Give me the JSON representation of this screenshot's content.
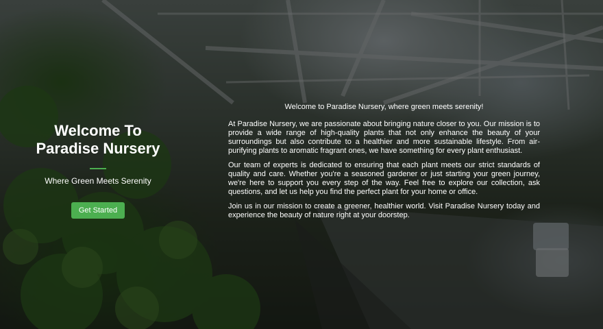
{
  "hero": {
    "title_line1": "Welcome To",
    "title_line2": "Paradise Nursery",
    "subtitle": "Where Green Meets Serenity",
    "cta_label": "Get Started",
    "accent_color": "#4caf50"
  },
  "about": {
    "intro": "Welcome to Paradise Nursery, where green meets serenity!",
    "paragraphs": [
      "At Paradise Nursery, we are passionate about bringing nature closer to you. Our mission is to provide a wide range of high-quality plants that not only enhance the beauty of your surroundings but also contribute to a healthier and more sustainable lifestyle. From air-purifying plants to aromatic fragrant ones, we have something for every plant enthusiast.",
      "Our team of experts is dedicated to ensuring that each plant meets our strict standards of quality and care. Whether you're a seasoned gardener or just starting your green journey, we're here to support you every step of the way. Feel free to explore our collection, ask questions, and let us help you find the perfect plant for your home or office.",
      "Join us in our mission to create a greener, healthier world. Visit Paradise Nursery today and experience the beauty of nature right at your doorstep."
    ]
  }
}
